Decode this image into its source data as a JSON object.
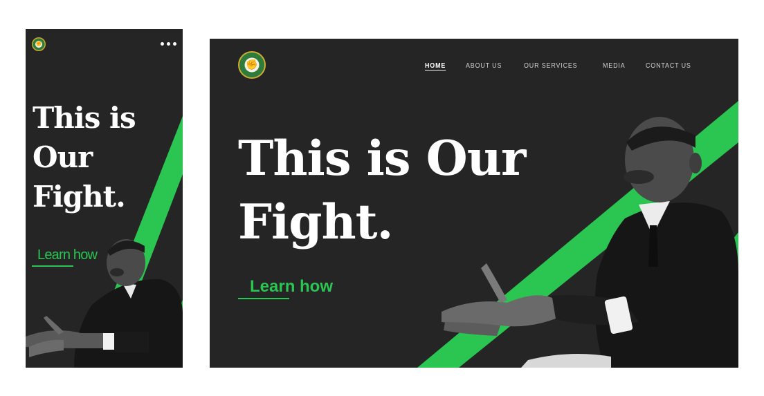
{
  "mobile": {
    "headline_line1": "This is",
    "headline_line2": "Our",
    "headline_line3": "Fight.",
    "cta_label": "Learn how",
    "menu_icon": "more-horizontal-icon"
  },
  "desktop": {
    "nav": {
      "items": [
        {
          "label": "HOME",
          "active": true
        },
        {
          "label": "ABOUT US",
          "active": false
        },
        {
          "label": "OUR SERVICES",
          "active": false
        },
        {
          "label": "MEDIA",
          "active": false
        },
        {
          "label": "CONTACT US",
          "active": false
        }
      ]
    },
    "headline_line1": "This is Our",
    "headline_line2": "Fight.",
    "cta_label": "Learn how"
  },
  "colors": {
    "background": "#252525",
    "accent": "#2bc552",
    "text": "#ffffff",
    "logo_green": "#2f7b3b",
    "logo_gold": "#d3b338"
  }
}
